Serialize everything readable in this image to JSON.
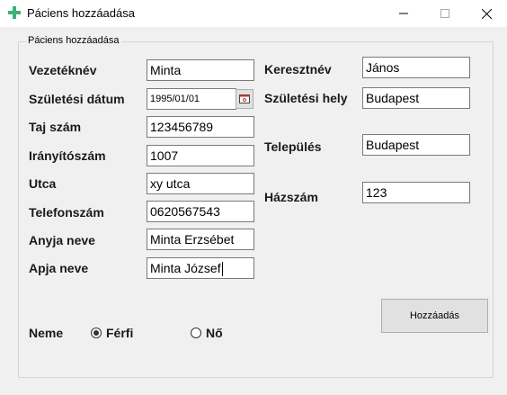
{
  "window": {
    "title": "Páciens hozzáadása"
  },
  "group": {
    "title": "Páciens hozzáadása"
  },
  "fields": {
    "vezeteknev": {
      "label": "Vezetéknév",
      "value": "Minta"
    },
    "keresztnev": {
      "label": "Keresztnév",
      "value": "János"
    },
    "szuletesi_datum": {
      "label": "Születési dátum",
      "value": "1995/01/01"
    },
    "szuletesi_hely": {
      "label": "Születési hely",
      "value": "Budapest"
    },
    "taj_szam": {
      "label": "Taj szám",
      "value": "123456789"
    },
    "iranyitoszam": {
      "label": "Irányítószám",
      "value": "1007"
    },
    "telepules": {
      "label": "Település",
      "value": "Budapest"
    },
    "utca": {
      "label": "Utca",
      "value": "xy utca"
    },
    "hazszam": {
      "label": "Házszám",
      "value": "123"
    },
    "telefonszam": {
      "label": "Telefonszám",
      "value": "0620567543"
    },
    "anyja_neve": {
      "label": "Anyja neve",
      "value": "Minta Erzsébet"
    },
    "apja_neve": {
      "label": "Apja neve",
      "value": "Minta József"
    }
  },
  "gender": {
    "label": "Neme",
    "options": [
      {
        "label": "Férfi",
        "selected": true
      },
      {
        "label": "Nő",
        "selected": false
      }
    ]
  },
  "buttons": {
    "add": "Hozzáadás"
  },
  "icons": {
    "app": "medical-cross-icon",
    "calendar": "calendar-icon"
  },
  "colors": {
    "app_icon": "#3bb273",
    "window_bg": "#f0f0f0",
    "button_bg": "#e1e1e1"
  }
}
